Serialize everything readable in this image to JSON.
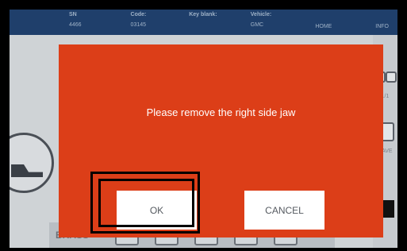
{
  "header": {
    "sn_label": "SN",
    "sn_value": "4466",
    "code_label": "Code:",
    "code_value": "03145",
    "key_blank_label": "Key blank:",
    "vehicle_label": "Vehicle:",
    "vehicle_value": "GMC",
    "home_label": "HOME",
    "info_label": "INFO"
  },
  "right_panel": {
    "page_count": "1/1",
    "save_label": "SAVE"
  },
  "bottom_bar": {
    "material_label": "BRASS"
  },
  "modal": {
    "message": "Please remove the right side jaw",
    "ok_label": "OK",
    "cancel_label": "CANCEL"
  },
  "colors": {
    "modal_background": "#dc3e18",
    "header_background": "#1f3f6b",
    "button_background": "#ffffff"
  }
}
